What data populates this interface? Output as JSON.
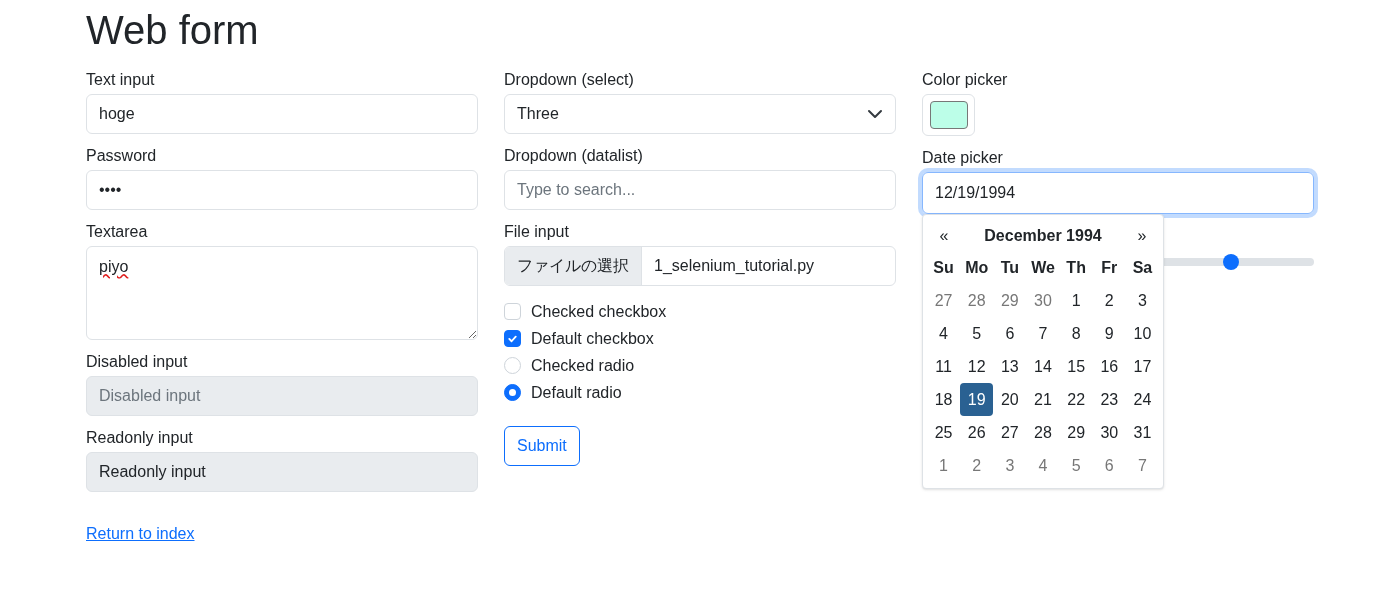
{
  "title": "Web form",
  "text_input": {
    "label": "Text input",
    "value": "hoge"
  },
  "password": {
    "label": "Password",
    "value": "••••"
  },
  "textarea": {
    "label": "Textarea",
    "value": "piyo"
  },
  "disabled_input": {
    "label": "Disabled input",
    "placeholder": "Disabled input",
    "disabled": true
  },
  "readonly_input": {
    "label": "Readonly input",
    "value": "Readonly input"
  },
  "return_link": "Return to index",
  "dropdown_select": {
    "label": "Dropdown (select)",
    "value": "Three"
  },
  "dropdown_datalist": {
    "label": "Dropdown (datalist)",
    "placeholder": "Type to search..."
  },
  "file_input": {
    "label": "File input",
    "button": "ファイルの選択",
    "value": "1_selenium_tutorial.py"
  },
  "choices": [
    {
      "kind": "checkbox",
      "label": "Checked checkbox",
      "checked": false
    },
    {
      "kind": "checkbox",
      "label": "Default checkbox",
      "checked": true
    },
    {
      "kind": "radio",
      "label": "Checked radio",
      "checked": false
    },
    {
      "kind": "radio",
      "label": "Default radio",
      "checked": true
    }
  ],
  "submit": "Submit",
  "color_picker": {
    "label": "Color picker",
    "color": "#bcfee8"
  },
  "date_picker": {
    "label": "Date picker",
    "value": "12/19/1994",
    "focused": true
  },
  "range": {
    "level": 0.8
  },
  "calendar": {
    "prev": "«",
    "month": "December 1994",
    "next": "»",
    "weekdays": [
      "Su",
      "Mo",
      "Tu",
      "We",
      "Th",
      "Fr",
      "Sa"
    ],
    "weeks": [
      [
        {
          "day": "27",
          "muted": true,
          "selected": false
        },
        {
          "day": "28",
          "muted": true,
          "selected": false
        },
        {
          "day": "29",
          "muted": true,
          "selected": false
        },
        {
          "day": "30",
          "muted": true,
          "selected": false
        },
        {
          "day": "1",
          "muted": false,
          "selected": false
        },
        {
          "day": "2",
          "muted": false,
          "selected": false
        },
        {
          "day": "3",
          "muted": false,
          "selected": false
        }
      ],
      [
        {
          "day": "4",
          "muted": false,
          "selected": false
        },
        {
          "day": "5",
          "muted": false,
          "selected": false
        },
        {
          "day": "6",
          "muted": false,
          "selected": false
        },
        {
          "day": "7",
          "muted": false,
          "selected": false
        },
        {
          "day": "8",
          "muted": false,
          "selected": false
        },
        {
          "day": "9",
          "muted": false,
          "selected": false
        },
        {
          "day": "10",
          "muted": false,
          "selected": false
        }
      ],
      [
        {
          "day": "11",
          "muted": false,
          "selected": false
        },
        {
          "day": "12",
          "muted": false,
          "selected": false
        },
        {
          "day": "13",
          "muted": false,
          "selected": false
        },
        {
          "day": "14",
          "muted": false,
          "selected": false
        },
        {
          "day": "15",
          "muted": false,
          "selected": false
        },
        {
          "day": "16",
          "muted": false,
          "selected": false
        },
        {
          "day": "17",
          "muted": false,
          "selected": false
        }
      ],
      [
        {
          "day": "18",
          "muted": false,
          "selected": false
        },
        {
          "day": "19",
          "muted": false,
          "selected": true
        },
        {
          "day": "20",
          "muted": false,
          "selected": false
        },
        {
          "day": "21",
          "muted": false,
          "selected": false
        },
        {
          "day": "22",
          "muted": false,
          "selected": false
        },
        {
          "day": "23",
          "muted": false,
          "selected": false
        },
        {
          "day": "24",
          "muted": false,
          "selected": false
        }
      ],
      [
        {
          "day": "25",
          "muted": false,
          "selected": false
        },
        {
          "day": "26",
          "muted": false,
          "selected": false
        },
        {
          "day": "27",
          "muted": false,
          "selected": false
        },
        {
          "day": "28",
          "muted": false,
          "selected": false
        },
        {
          "day": "29",
          "muted": false,
          "selected": false
        },
        {
          "day": "30",
          "muted": false,
          "selected": false
        },
        {
          "day": "31",
          "muted": false,
          "selected": false
        }
      ],
      [
        {
          "day": "1",
          "muted": true,
          "selected": false
        },
        {
          "day": "2",
          "muted": true,
          "selected": false
        },
        {
          "day": "3",
          "muted": true,
          "selected": false
        },
        {
          "day": "4",
          "muted": true,
          "selected": false
        },
        {
          "day": "5",
          "muted": true,
          "selected": false
        },
        {
          "day": "6",
          "muted": true,
          "selected": false
        },
        {
          "day": "7",
          "muted": true,
          "selected": false
        }
      ]
    ]
  }
}
